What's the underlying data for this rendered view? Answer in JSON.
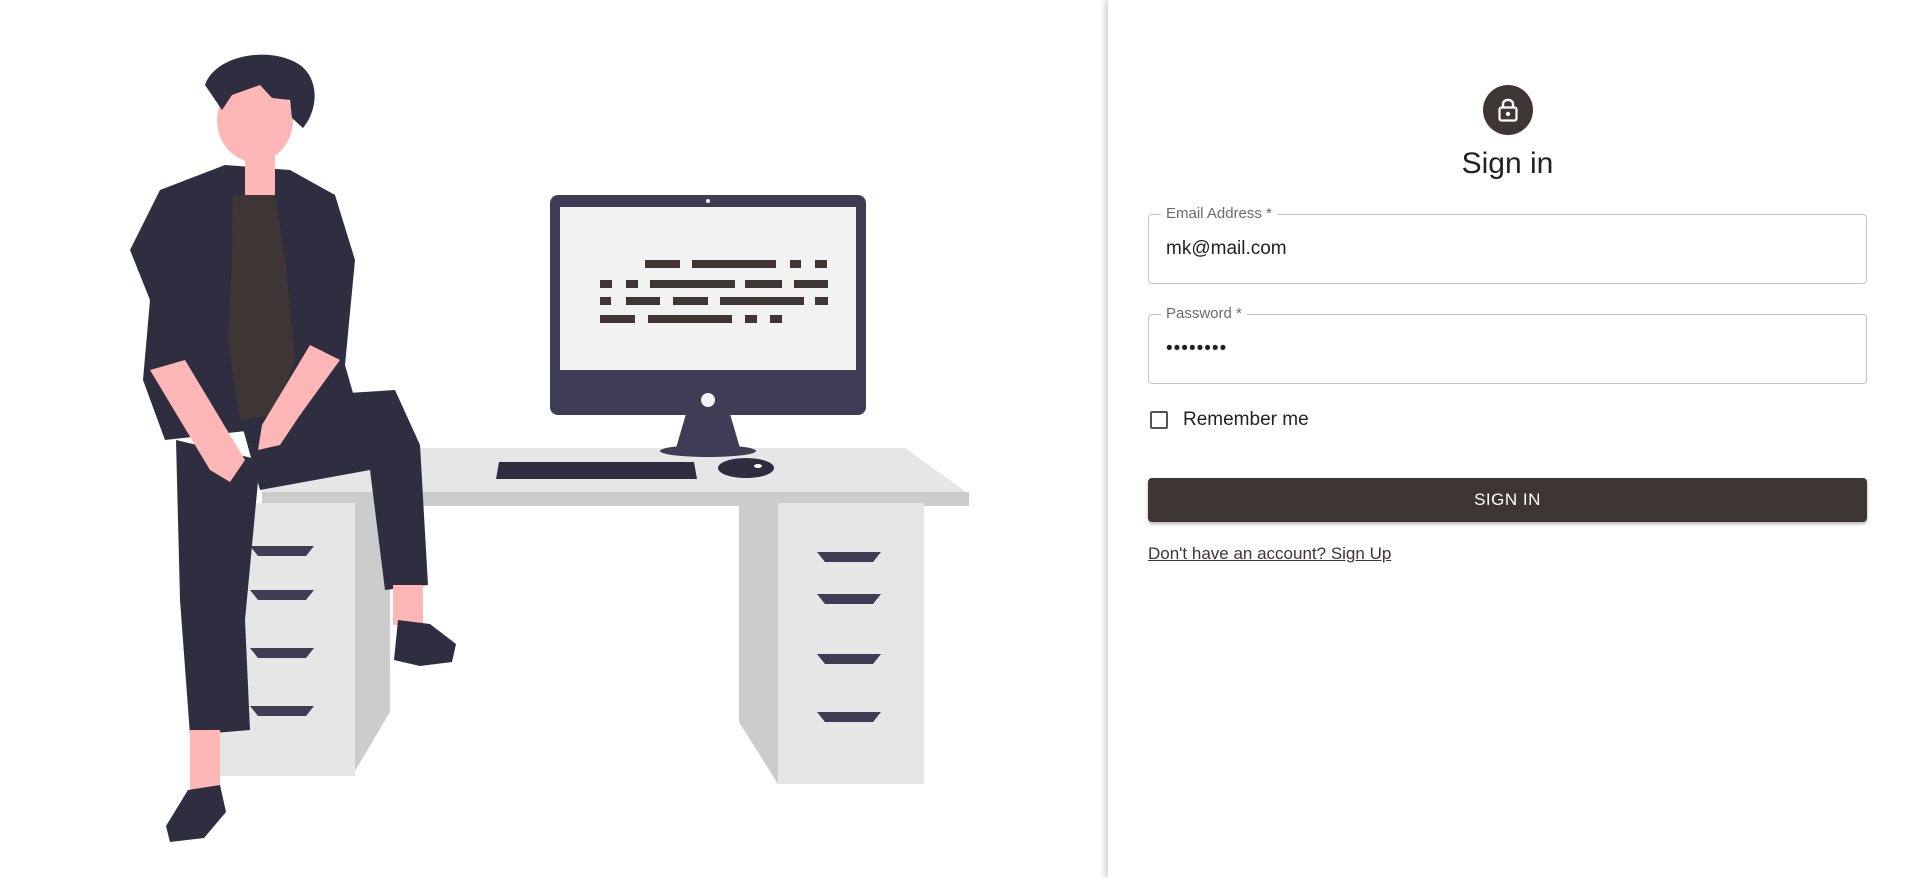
{
  "illustration": {
    "icon": "person-at-desk-illustration"
  },
  "form": {
    "lock_icon": "lock-icon",
    "title": "Sign in",
    "email": {
      "label": "Email Address *",
      "value": "mk@mail.com"
    },
    "password": {
      "label": "Password *",
      "value": "••••••••"
    },
    "remember_label": "Remember me",
    "remember_checked": false,
    "submit_label": "SIGN IN",
    "signup_link": "Don't have an account? Sign Up"
  },
  "colors": {
    "primary": "#3e3535",
    "dark_navy": "#2f2e41",
    "skin": "#ffb6b6",
    "desk_light": "#e6e6e6",
    "desk_dark": "#cccccc",
    "screen": "#f2f2f2"
  }
}
